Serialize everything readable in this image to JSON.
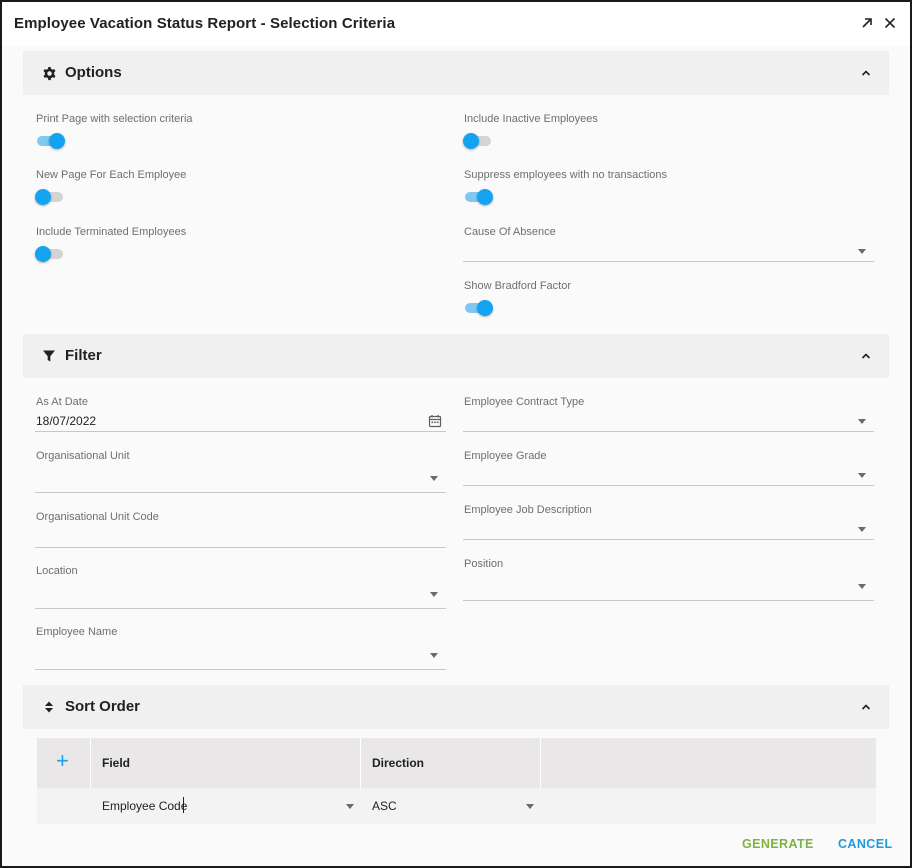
{
  "dialog": {
    "title": "Employee Vacation Status Report - Selection Criteria",
    "expand_icon": "arrow-up-right-icon",
    "close_icon": "close-icon"
  },
  "options": {
    "title": "Options",
    "icon": "gear-icon",
    "print_page": {
      "label": "Print Page with selection criteria",
      "checked": true
    },
    "new_page": {
      "label": "New Page For Each Employee",
      "checked": false
    },
    "include_terminated": {
      "label": "Include Terminated Employees",
      "checked": false
    },
    "include_inactive": {
      "label": "Include Inactive Employees",
      "checked": false
    },
    "suppress_no_transactions": {
      "label": "Suppress employees with no transactions",
      "checked": true
    },
    "cause_of_absence": {
      "label": "Cause Of Absence",
      "value": ""
    },
    "show_bradford": {
      "label": "Show Bradford Factor",
      "checked": true
    }
  },
  "filter": {
    "title": "Filter",
    "icon": "filter-icon",
    "as_at_date": {
      "label": "As At Date",
      "value": "18/07/2022"
    },
    "org_unit": {
      "label": "Organisational Unit",
      "value": ""
    },
    "org_unit_code": {
      "label": "Organisational Unit Code",
      "value": ""
    },
    "location": {
      "label": "Location",
      "value": ""
    },
    "employee_name": {
      "label": "Employee Name",
      "value": ""
    },
    "contract_type": {
      "label": "Employee Contract Type",
      "value": ""
    },
    "grade": {
      "label": "Employee Grade",
      "value": ""
    },
    "job_description": {
      "label": "Employee Job Description",
      "value": ""
    },
    "position": {
      "label": "Position",
      "value": ""
    }
  },
  "sort_order": {
    "title": "Sort Order",
    "icon": "sort-icon",
    "add_symbol": "+",
    "columns": {
      "field": "Field",
      "direction": "Direction"
    },
    "rows": [
      {
        "field": "Employee Code",
        "direction": "ASC"
      }
    ]
  },
  "footer": {
    "generate_label": "GENERATE",
    "cancel_label": "CANCEL"
  },
  "colors": {
    "accent": "#14a3f0",
    "generate": "#7cb342",
    "cancel": "#1e9be0"
  }
}
